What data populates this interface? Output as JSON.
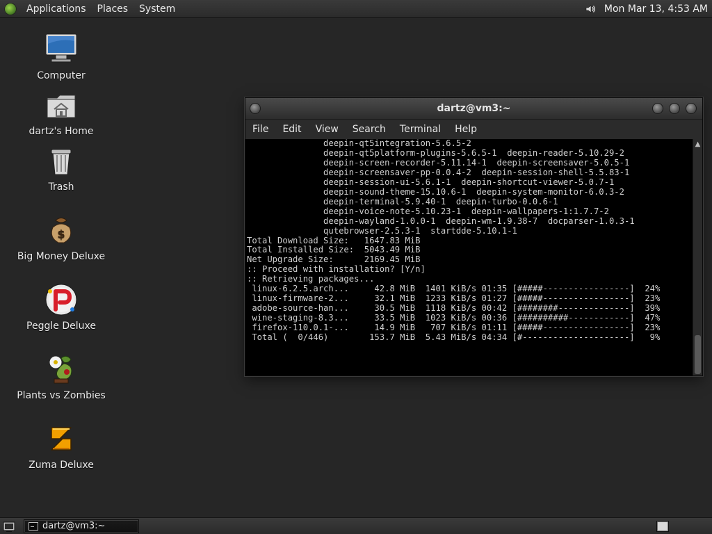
{
  "top_panel": {
    "menus": [
      "Applications",
      "Places",
      "System"
    ],
    "clock": "Mon Mar 13,  4:53 AM",
    "volume_icon": "volume-icon"
  },
  "desktop": {
    "icons": [
      {
        "label": "Computer",
        "icon": "computer-icon"
      },
      {
        "label": "dartz's Home",
        "icon": "home-folder-icon"
      },
      {
        "label": "Trash",
        "icon": "trash-icon"
      },
      {
        "label": "Big Money Deluxe",
        "icon": "money-bag-icon"
      },
      {
        "label": "Peggle Deluxe",
        "icon": "peggle-icon"
      },
      {
        "label": "Plants vs Zombies",
        "icon": "plants-vs-zombies-icon"
      },
      {
        "label": "Zuma Deluxe",
        "icon": "zuma-icon"
      }
    ]
  },
  "terminal": {
    "title": "dartz@vm3:~",
    "menu": [
      "File",
      "Edit",
      "View",
      "Search",
      "Terminal",
      "Help"
    ],
    "lines": [
      "               deepin-qt5integration-5.6.5-2",
      "               deepin-qt5platform-plugins-5.6.5-1  deepin-reader-5.10.29-2",
      "               deepin-screen-recorder-5.11.14-1  deepin-screensaver-5.0.5-1",
      "               deepin-screensaver-pp-0.0.4-2  deepin-session-shell-5.5.83-1",
      "               deepin-session-ui-5.6.1-1  deepin-shortcut-viewer-5.0.7-1",
      "               deepin-sound-theme-15.10.6-1  deepin-system-monitor-6.0.3-2",
      "               deepin-terminal-5.9.40-1  deepin-turbo-0.0.6-1",
      "               deepin-voice-note-5.10.23-1  deepin-wallpapers-1:1.7.7-2",
      "               deepin-wayland-1.0.0-1  deepin-wm-1.9.38-7  docparser-1.0.3-1",
      "               qutebrowser-2.5.3-1  startdde-5.10.1-1",
      "",
      "Total Download Size:   1647.83 MiB",
      "Total Installed Size:  5043.49 MiB",
      "Net Upgrade Size:      2169.45 MiB",
      "",
      ":: Proceed with installation? [Y/n]",
      ":: Retrieving packages...",
      " linux-6.2.5.arch...     42.8 MiB  1401 KiB/s 01:35 [#####-----------------]  24%",
      " linux-firmware-2...     32.1 MiB  1233 KiB/s 01:27 [#####-----------------]  23%",
      " adobe-source-han...     30.5 MiB  1118 KiB/s 00:42 [########--------------]  39%",
      " wine-staging-8.3...     33.5 MiB  1023 KiB/s 00:36 [##########------------]  47%",
      " firefox-110.0.1-...     14.9 MiB   707 KiB/s 01:11 [#####-----------------]  23%",
      " Total (  0/446)        153.7 MiB  5.43 MiB/s 04:34 [#---------------------]   9%"
    ]
  },
  "taskbar": {
    "task_title": "dartz@vm3:~"
  }
}
